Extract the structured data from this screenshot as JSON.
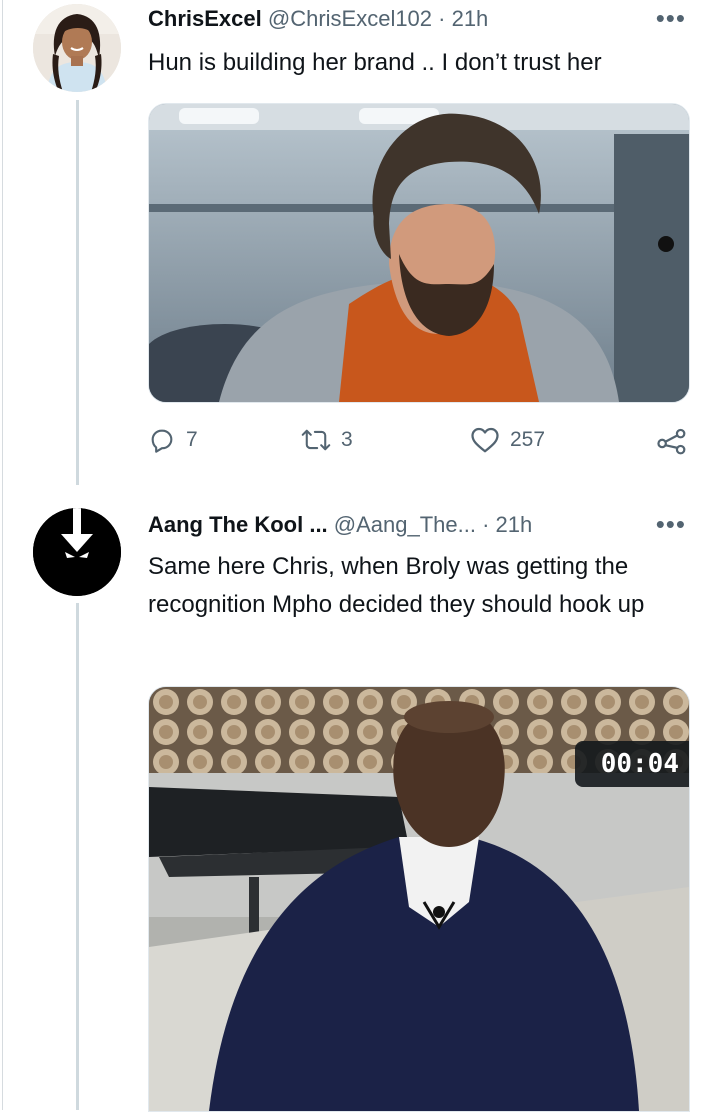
{
  "tweet1": {
    "display_name": "ChrisExcel",
    "handle_time": "@ChrisExcel102 · 21h",
    "more": "•••",
    "text": "Hun is building her brand .. I don’t trust her",
    "actions": {
      "replies": "7",
      "retweets": "3",
      "likes": "257"
    }
  },
  "tweet2": {
    "display_name": "Aang The Kool ...",
    "handle_time": "@Aang_The... · 21h",
    "more": "•••",
    "text": "Same here Chris, when Broly was getting the recognition Mpho decided they should hook up",
    "video_time": "00:04"
  },
  "colors": {
    "text": "#0f1419",
    "secondary": "#536471",
    "thread_line": "#cfd9de"
  },
  "icons": [
    "reply-icon",
    "retweet-icon",
    "like-icon",
    "share-icon",
    "more-icon"
  ]
}
